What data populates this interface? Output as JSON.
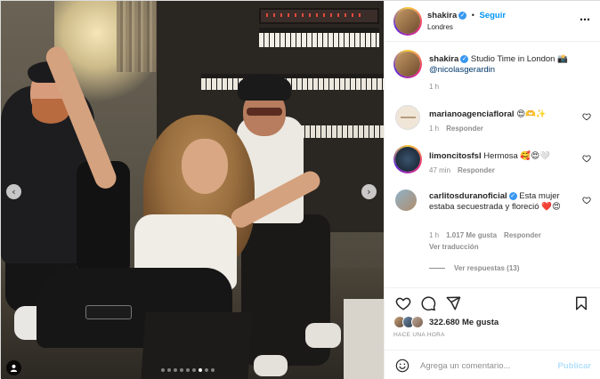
{
  "post": {
    "author": "shakira",
    "follow_label": "Seguir",
    "location": "Londres",
    "caption_user": "shakira",
    "caption_text": "Studio Time in London 📸",
    "caption_mention": "@nicolasgerardin",
    "caption_time": "1 h",
    "image_count": 9,
    "active_index": 6
  },
  "comments": [
    {
      "user": "marianoagenciafloral",
      "text": "😍🫶✨",
      "time": "1 h",
      "reply": "Responder",
      "avatar_color": "#f0e6d8"
    },
    {
      "user": "limoncitosfsl",
      "text": "Hermosa 🥰😍🤍",
      "time": "47 min",
      "reply": "Responder",
      "avatar_color": "#1f2d3d"
    },
    {
      "user": "carlitosduranoficial",
      "verified": true,
      "text": "Esta mujer estaba secuestrada y floreció ❤️😍",
      "time": "1 h",
      "likes": "1.017 Me gusta",
      "reply": "Responder",
      "translate": "Ver traducción",
      "avatar_color": "#b08c6c"
    }
  ],
  "view_replies": "Ver respuestas (13)",
  "likes": {
    "count": "322.680 Me gusta"
  },
  "posted": "HACE UNA HORA",
  "composer": {
    "placeholder": "Agrega un comentario...",
    "publish": "Publicar"
  },
  "colors": {
    "accent": "#0095f6",
    "verified": "#3897f0",
    "like_red": "#ed4956"
  }
}
